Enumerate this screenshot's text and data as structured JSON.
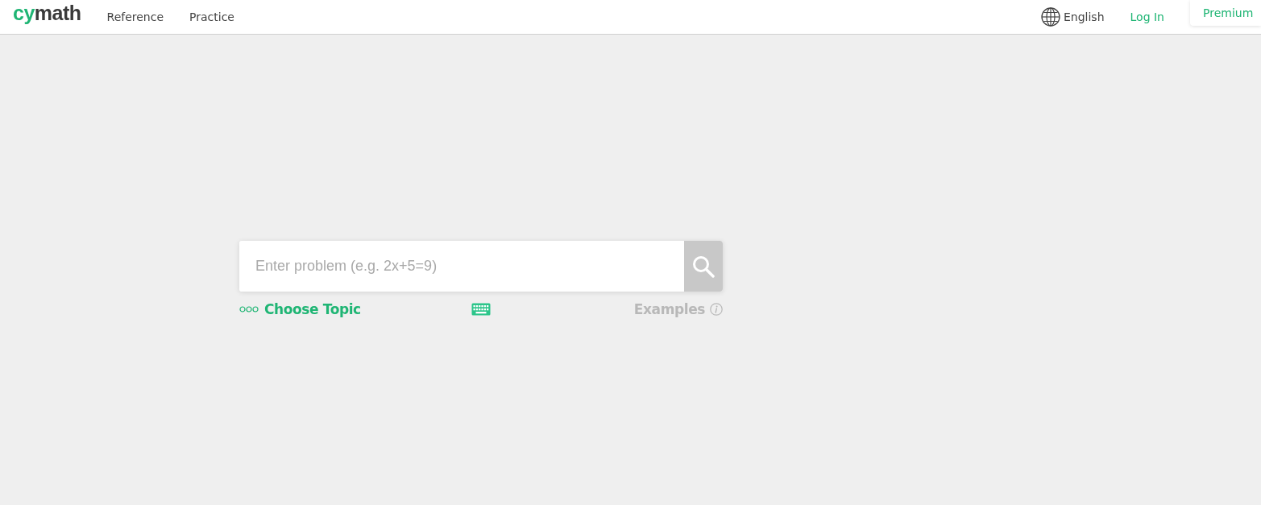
{
  "header": {
    "logo": {
      "accent": "cy",
      "rest": "math"
    },
    "nav": [
      "Reference",
      "Practice"
    ],
    "language": "English",
    "login": "Log In",
    "premium": "Premium"
  },
  "search": {
    "placeholder": "Enter problem (e.g. 2x+5=9)"
  },
  "tools": {
    "choose_topic": "Choose Topic",
    "examples": "Examples"
  }
}
